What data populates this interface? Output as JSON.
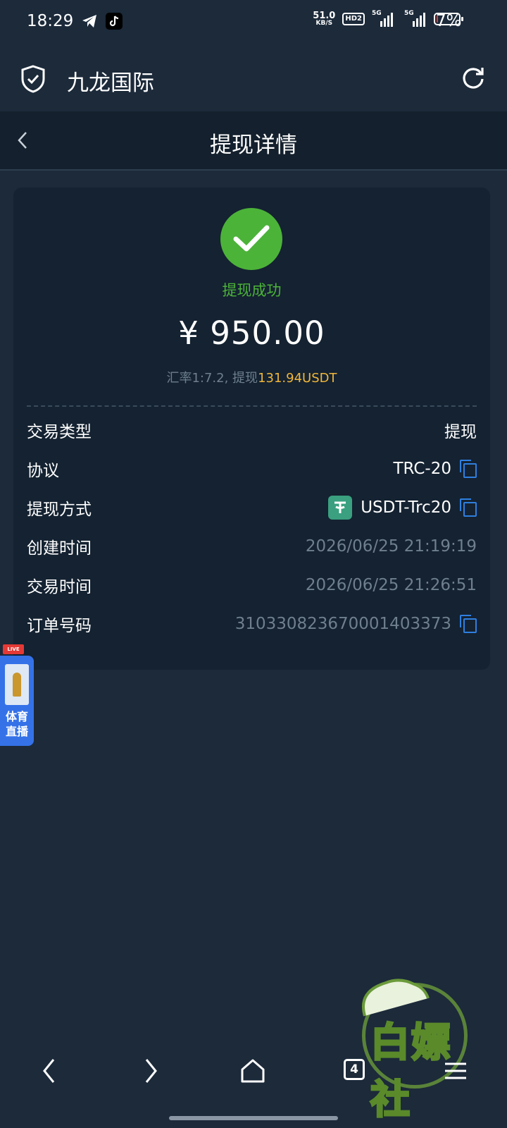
{
  "status_bar": {
    "time": "18:29",
    "net_speed_value": "51.0",
    "net_speed_unit": "KB/S",
    "hd_badge": "HD2",
    "signal_1_label": "5G",
    "signal_2_label": "5G",
    "battery_percent": "7%",
    "battery_level": 0.07,
    "icons": [
      "telegram-icon",
      "tiktok-icon"
    ]
  },
  "app_header": {
    "title": "九龙国际",
    "left_icon": "shield-check-icon",
    "right_icon": "refresh-icon"
  },
  "nav": {
    "title": "提现详情",
    "back_icon": "chevron-left-icon"
  },
  "summary": {
    "status": "提现成功",
    "amount": "¥ 950.00",
    "rate_prefix": "汇率1:7.2, 提现",
    "rate_highlight": "131.94USDT"
  },
  "details": [
    {
      "label": "交易类型",
      "value": "提现",
      "copyable": false
    },
    {
      "label": "协议",
      "value": "TRC-20",
      "copyable": true
    },
    {
      "label": "提现方式",
      "value": "USDT-Trc20",
      "copyable": true,
      "icon": "tether-icon"
    },
    {
      "label": "创建时间",
      "value": "2026/06/25 21:19:19",
      "copyable": false
    },
    {
      "label": "交易时间",
      "value": "2026/06/25 21:26:51",
      "copyable": false
    },
    {
      "label": "订单号码",
      "value": "3103308236700014033​73",
      "copyable": true
    }
  ],
  "floating_badge": {
    "tag": "LIVE",
    "label_line1": "体育",
    "label_line2": "直播"
  },
  "watermark": {
    "text": "白嫖社"
  },
  "bottom_nav": {
    "tab_count": "4",
    "icons": [
      "back-arrow-icon",
      "forward-arrow-icon",
      "home-icon",
      "tabs-icon",
      "menu-icon"
    ]
  },
  "colors": {
    "background": "#1c2a3a",
    "card": "#142231",
    "success": "#4cb339",
    "highlight": "#f0b63a",
    "copy": "#2f7fe0",
    "muted": "#6f7f8e"
  }
}
